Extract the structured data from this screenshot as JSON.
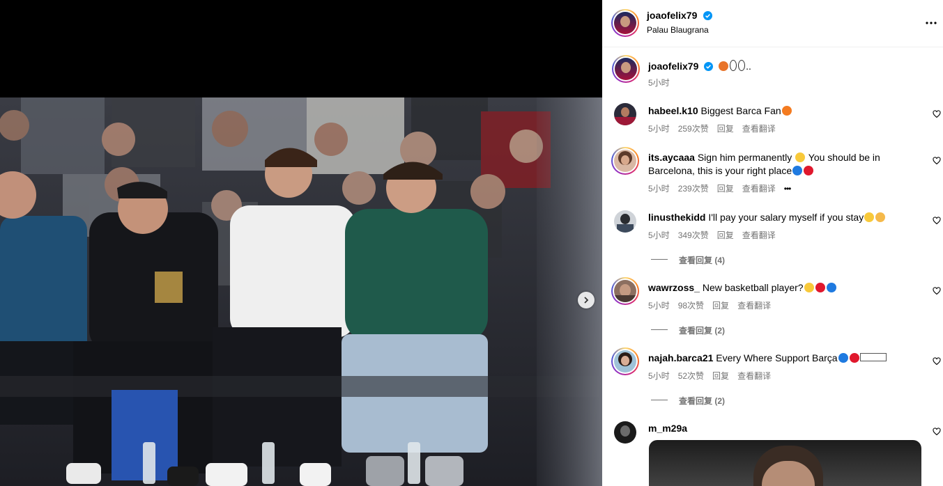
{
  "header": {
    "username": "joaofelix79",
    "location": "Palau Blaugrana"
  },
  "caption": {
    "username": "joaofelix79",
    "suffix": "..",
    "time": "5小时"
  },
  "comments": [
    {
      "username": "habeel.k10",
      "text": "Biggest Barca Fan",
      "time": "5小时",
      "likes": "259次赞",
      "reply": "回复",
      "translate": "查看翻译"
    },
    {
      "username": "its.aycaaa",
      "text": "Sign him permanently",
      "text2": "You should be in",
      "text3": "Barcelona, this is your right place",
      "time": "5小时",
      "likes": "239次赞",
      "reply": "回复",
      "translate": "查看翻译",
      "more": "•••"
    },
    {
      "username": "linusthekidd",
      "text": "I'll pay your salary myself if you stay",
      "time": "5小时",
      "likes": "349次赞",
      "reply": "回复",
      "translate": "查看翻译",
      "view_replies": "查看回复 (4)"
    },
    {
      "username": "wawrzoss_",
      "text": "New basketball player?",
      "time": "5小时",
      "likes": "98次赞",
      "reply": "回复",
      "translate": "查看翻译",
      "view_replies": "查看回复 (2)"
    },
    {
      "username": "najah.barca21",
      "text": "Every Where Support Barça",
      "time": "5小时",
      "likes": "52次赞",
      "reply": "回复",
      "translate": "查看翻译",
      "view_replies": "查看回复 (2)"
    },
    {
      "username": "m_m29a"
    }
  ],
  "icons": {
    "more": "more-horizontal-icon",
    "verified": "verified-badge-icon",
    "heart": "heart-outline-icon",
    "next": "chevron-right-icon"
  },
  "colors": {
    "verified": "#0095f6",
    "secondary_text": "#737373",
    "divider": "#efefef"
  }
}
